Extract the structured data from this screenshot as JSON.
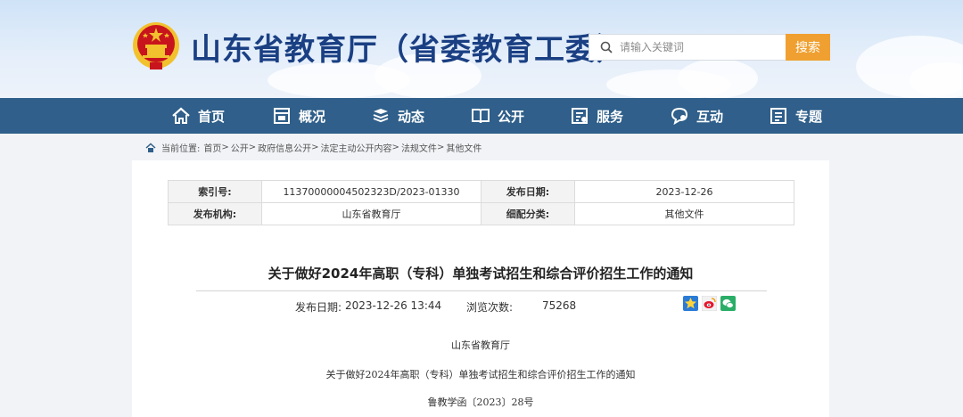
{
  "header": {
    "site_title": "山东省教育厅（省委教育工委）",
    "search_placeholder": "请输入关键词",
    "search_button": "搜索"
  },
  "nav": [
    {
      "label": "首页",
      "icon": "home-icon"
    },
    {
      "label": "概况",
      "icon": "overview-icon"
    },
    {
      "label": "动态",
      "icon": "news-icon"
    },
    {
      "label": "公开",
      "icon": "book-icon"
    },
    {
      "label": "服务",
      "icon": "service-icon"
    },
    {
      "label": "互动",
      "icon": "chat-icon"
    },
    {
      "label": "专题",
      "icon": "topic-icon"
    }
  ],
  "breadcrumb": {
    "prefix": "当前位置:",
    "items": [
      "首页",
      "公开",
      "政府信息公开",
      "法定主动公开内容",
      "法规文件",
      "其他文件"
    ],
    "separator": ">"
  },
  "meta": {
    "index_label": "索引号:",
    "index_value": "11370000004502323D/2023-01330",
    "date_label": "发布日期:",
    "date_value": "2023-12-26",
    "org_label": "发布机构:",
    "org_value": "山东省教育厅",
    "category_label": "细配分类:",
    "category_value": "其他文件"
  },
  "article": {
    "title": "关于做好2024年高职（专科）单独考试招生和综合评价招生工作的通知",
    "pub_label": "发布日期:",
    "pub_value": "2023-12-26 13:44",
    "views_label": "浏览次数:",
    "views_value": "75268",
    "share_icons": [
      "favorite-star-icon",
      "weibo-icon",
      "wechat-icon"
    ],
    "body_org": "山东省教育厅",
    "body_title": "关于做好2024年高职（专科）单独考试招生和综合评价招生工作的通知",
    "doc_number": "鲁教学函〔2023〕28号"
  },
  "colors": {
    "title_blue": "#1a3f83",
    "nav_blue": "#2f5f8a",
    "search_orange": "#f0a030",
    "emblem_red": "#c8141c",
    "emblem_gold": "#f2c12e"
  }
}
